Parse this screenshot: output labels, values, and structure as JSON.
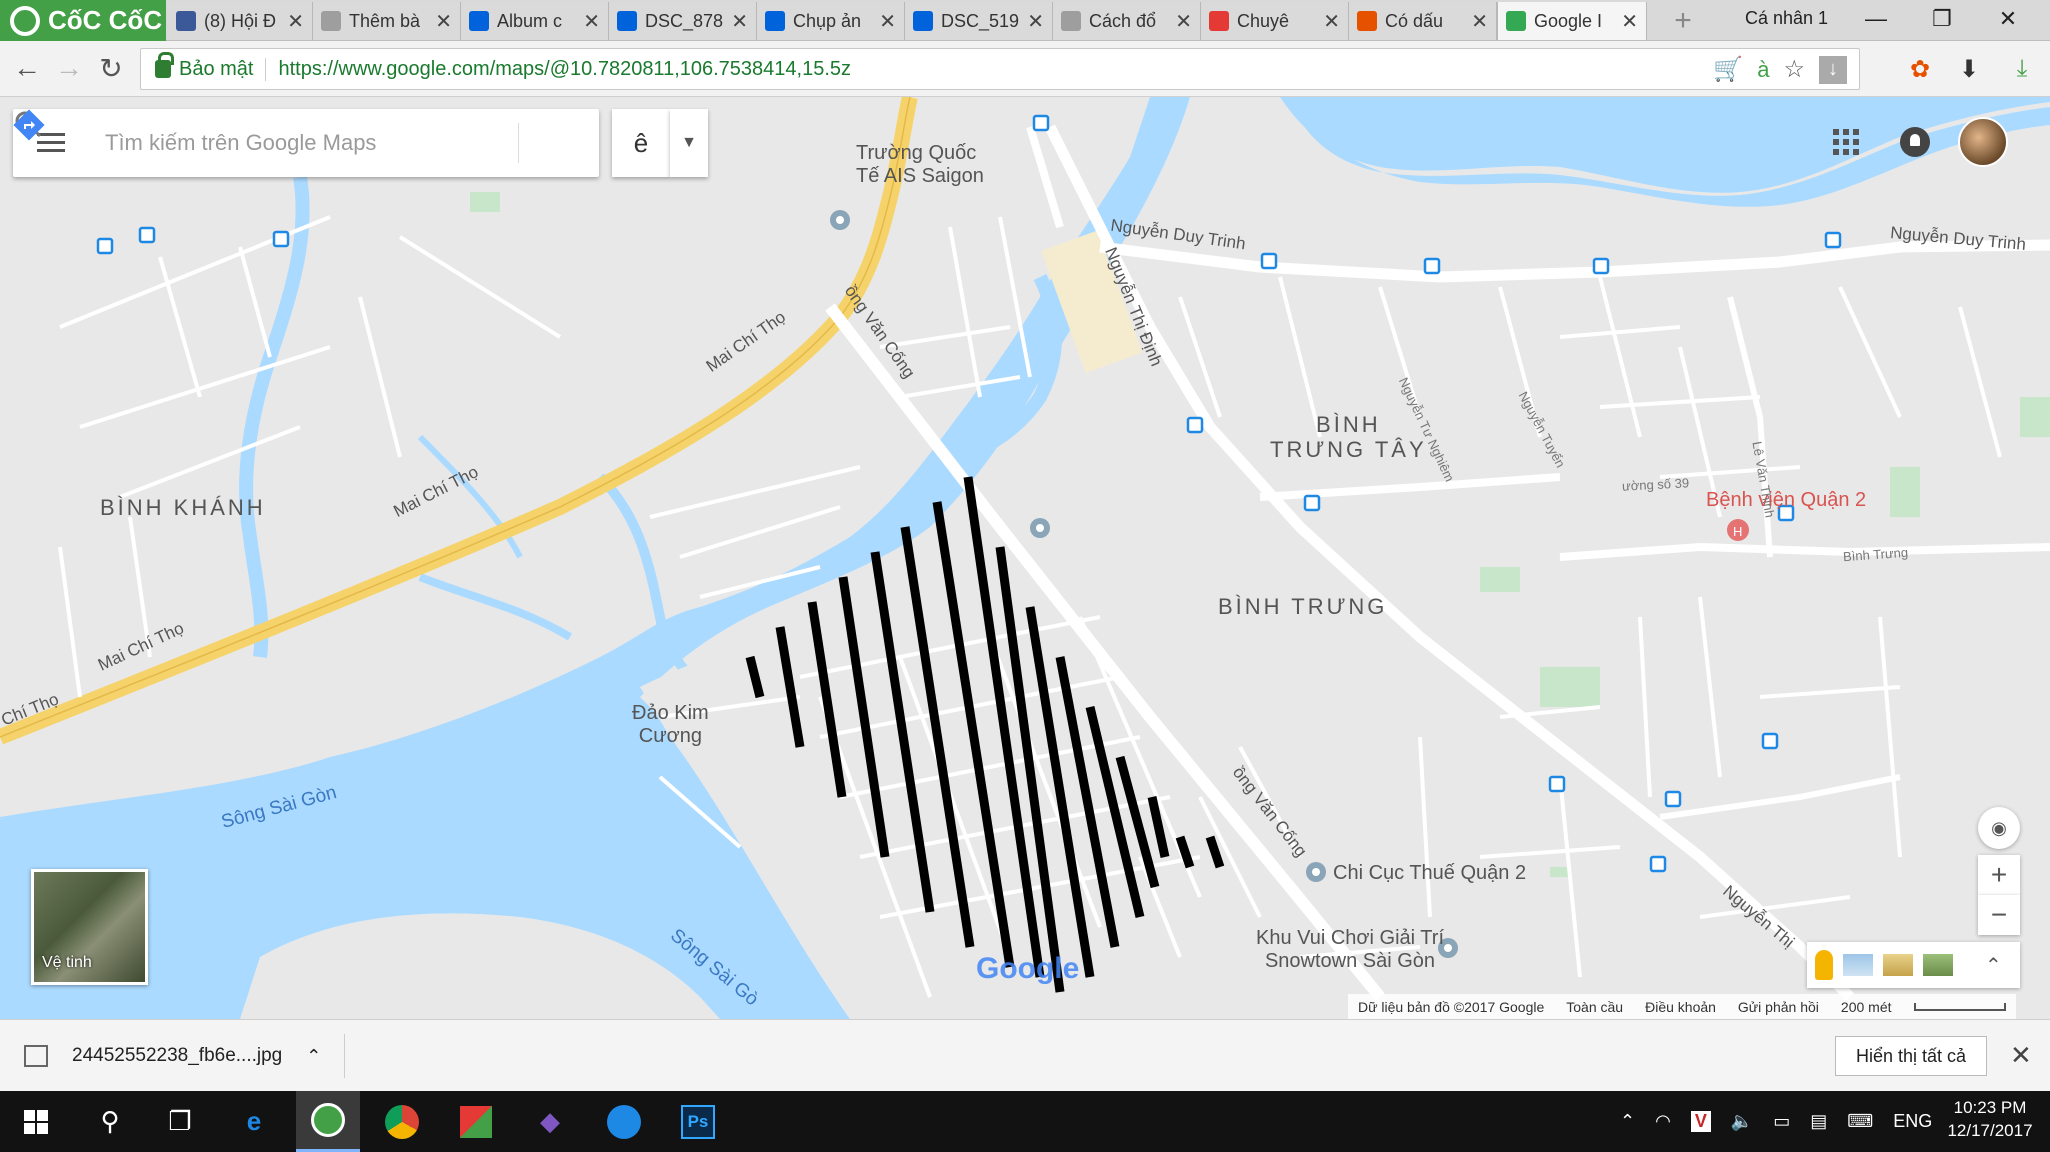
{
  "browser": {
    "brand": "CốC CốC",
    "profile": "Cá nhân 1",
    "tabs": [
      {
        "title": "(8) Hội Đ",
        "favicon": "facebook-icon",
        "color": "#3b5998"
      },
      {
        "title": "Thêm bà",
        "favicon": "page-icon",
        "color": "#9e9e9e"
      },
      {
        "title": "Album c",
        "favicon": "flickr-icon",
        "color": "#0063dc"
      },
      {
        "title": "DSC_878",
        "favicon": "flickr-icon",
        "color": "#0063dc"
      },
      {
        "title": "Chụp ản",
        "favicon": "flickr-icon",
        "color": "#0063dc"
      },
      {
        "title": "DSC_519",
        "favicon": "flickr-icon",
        "color": "#0063dc"
      },
      {
        "title": "Cách đổ",
        "favicon": "page-icon",
        "color": "#9e9e9e"
      },
      {
        "title": "Chuyê",
        "favicon": "youtube-icon",
        "color": "#e53935"
      },
      {
        "title": "Có dấu",
        "favicon": "site-icon",
        "color": "#e65100"
      },
      {
        "title": "Google I",
        "favicon": "google-maps-icon",
        "color": "#34a853",
        "active": true
      }
    ],
    "address": {
      "security_label": "Bảo mật",
      "url": "https://www.google.com/maps/@10.7820811,106.7538414,15.5z",
      "ime_indicator": "à"
    }
  },
  "maps": {
    "search_placeholder": "Tìm kiếm trên Google Maps",
    "ime_char": "ê",
    "satellite_label": "Vệ tinh",
    "attribution": {
      "data": "Dữ liệu bản đồ ©2017 Google",
      "global": "Toàn cầu",
      "terms": "Điều khoản",
      "feedback": "Gửi phản hồi",
      "scale": "200 mét"
    },
    "areas": [
      {
        "text": "BÌNH KHÁNH"
      },
      {
        "text": "BÌNH\nTRƯNG TÂY"
      },
      {
        "text": "BÌNH TRƯNG"
      }
    ],
    "pois": {
      "school": "Trường Quốc\nTế AIS Saigon",
      "island": "Đảo Kim\nCương",
      "hospital": "Bệnh viện Quận 2",
      "tax": "Chi Cục Thuế Quận 2",
      "park": "Khu Vui Chơi Giải Trí\nSnowtown Sài Gòn"
    },
    "roads": {
      "mai_chi_tho_1": "Mai Chí Thọ",
      "mai_chi_tho_2": "Mai Chí Thọ",
      "mai_chi_tho_3": "Mai Chí Thọ",
      "mai_chi_tho_4": "Chí Thọ",
      "nguyen_duy_trinh_1": "Nguyễn Duy Trinh",
      "nguyen_duy_trinh_2": "Nguyễn Duy Trinh",
      "nguyen_thi_dinh": "Nguyễn Thị Định",
      "dong_van_cong_1": "ồng Văn Cống",
      "dong_van_cong_2": "ồng Văn Cống",
      "nguyen_thi_2": "Nguyễn Thị",
      "binh_trung": "Bình Trưng",
      "duong_so_39": "ường số 39",
      "le_van_thinh": "Lê Văn Thịnh",
      "nguyen_tu_nghiem": "Nguyễn Tư Nghiêm",
      "nguyen_tuyen": "Nguyễn Tuyển"
    },
    "water": {
      "song_sai_gon_1": "Sông Sài Gòn",
      "song_sai_gon_2": "Sông Sài Gò"
    },
    "logo": "Google"
  },
  "download": {
    "file": "24452552238_fb6e....jpg",
    "show_all": "Hiển thị tất cả"
  },
  "taskbar": {
    "lang": "ENG",
    "time": "10:23 PM",
    "date": "12/17/2017"
  }
}
